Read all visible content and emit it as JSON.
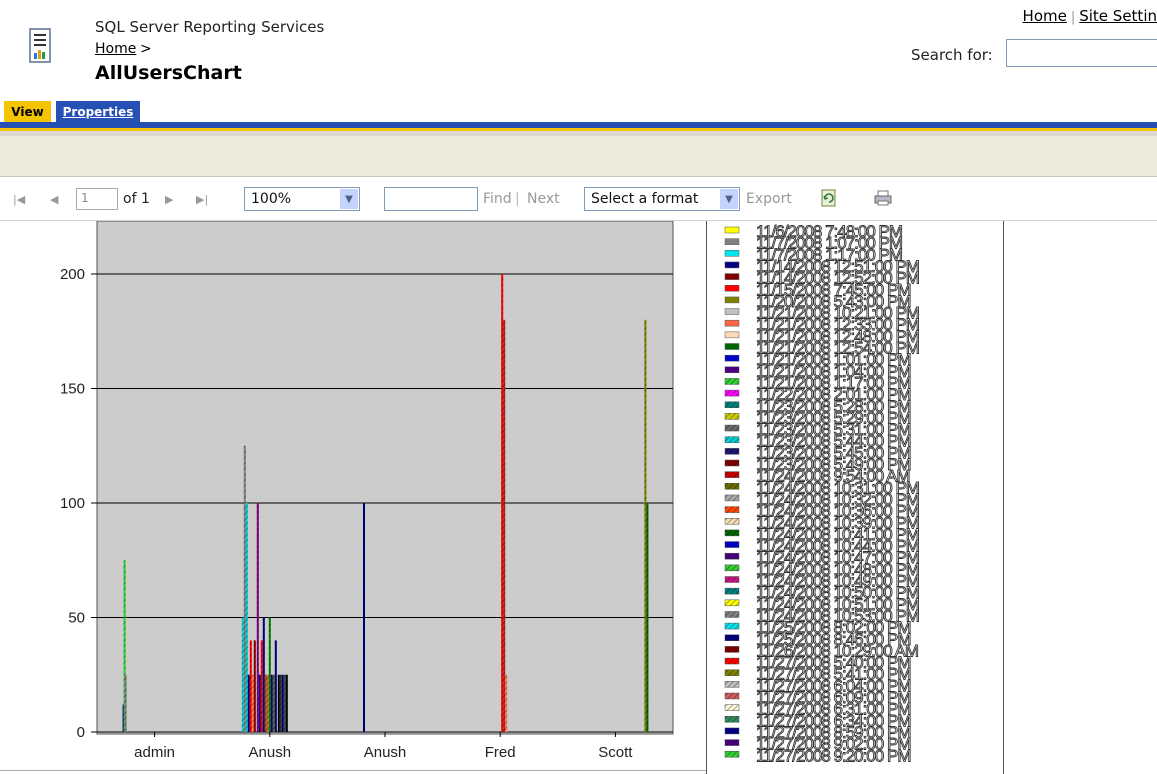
{
  "header": {
    "app_name": "SQL Server Reporting Services",
    "breadcrumb_home": "Home",
    "breadcrumb_sep": ">",
    "report_title": "AllUsersChart",
    "top_links": [
      "Home",
      "Site Settin"
    ],
    "search_label": "Search for:"
  },
  "tabs": [
    {
      "label": "View",
      "active": true
    },
    {
      "label": "Properties",
      "active": false
    }
  ],
  "toolbar": {
    "page_value": "1",
    "page_of": "of 1",
    "zoom": "100%",
    "find_label": "Find",
    "find_sep": "|",
    "next_label": "Next",
    "format_placeholder": "Select a format",
    "export_label": "Export"
  },
  "colors": {
    "tab_view": "#f4c400",
    "tab_properties": "#2650b3",
    "plot_background": "#cccccc"
  },
  "chart_data": {
    "type": "bar",
    "categories": [
      "admin",
      "Anush",
      "Anush",
      "Fred",
      "Scott"
    ],
    "y_ticks": [
      0,
      50,
      100,
      150,
      200
    ],
    "ylim": [
      0,
      220
    ],
    "grid": true,
    "legend_position": "right",
    "bars": [
      {
        "cat": 0,
        "off": -32,
        "v": 12,
        "c": "#000080"
      },
      {
        "cat": 0,
        "off": -31,
        "v": 75,
        "c": "#32cd32"
      },
      {
        "cat": 0,
        "off": -30,
        "v": 25,
        "c": "#808080"
      },
      {
        "cat": 1,
        "off": -28,
        "v": 50,
        "c": "#00ced1"
      },
      {
        "cat": 1,
        "off": -26,
        "v": 125,
        "c": "#808080"
      },
      {
        "cat": 1,
        "off": -24,
        "v": 100,
        "c": "#00ced1"
      },
      {
        "cat": 1,
        "off": -22,
        "v": 25,
        "c": "#000080"
      },
      {
        "cat": 1,
        "off": -20,
        "v": 40,
        "c": "#ff0000"
      },
      {
        "cat": 1,
        "off": -18,
        "v": 25,
        "c": "#ff7f50"
      },
      {
        "cat": 1,
        "off": -16,
        "v": 40,
        "c": "#8b0000"
      },
      {
        "cat": 1,
        "off": -13,
        "v": 100,
        "c": "#800080"
      },
      {
        "cat": 1,
        "off": -11,
        "v": 25,
        "c": "#000080"
      },
      {
        "cat": 1,
        "off": -9,
        "v": 40,
        "c": "#ff0000"
      },
      {
        "cat": 1,
        "off": -7,
        "v": 50,
        "c": "#000080"
      },
      {
        "cat": 1,
        "off": -5,
        "v": 25,
        "c": "#a0522d"
      },
      {
        "cat": 1,
        "off": -3,
        "v": 25,
        "c": "#d2691e"
      },
      {
        "cat": 1,
        "off": -1,
        "v": 50,
        "c": "#008000"
      },
      {
        "cat": 1,
        "off": 1,
        "v": 25,
        "c": "#000080"
      },
      {
        "cat": 1,
        "off": 3,
        "v": 25,
        "c": "#556b2f"
      },
      {
        "cat": 1,
        "off": 5,
        "v": 40,
        "c": "#000080"
      },
      {
        "cat": 1,
        "off": 8,
        "v": 25,
        "c": "#000000"
      },
      {
        "cat": 1,
        "off": 10,
        "v": 25,
        "c": "#333333"
      },
      {
        "cat": 1,
        "off": 12,
        "v": 25,
        "c": "#000080"
      },
      {
        "cat": 1,
        "off": 14,
        "v": 25,
        "c": "#2f4f4f"
      },
      {
        "cat": 1,
        "off": 16,
        "v": 25,
        "c": "#000000"
      },
      {
        "cat": 2,
        "off": -22,
        "v": 100,
        "c": "#000080"
      },
      {
        "cat": 3,
        "off": 1,
        "v": 200,
        "c": "#ff0000"
      },
      {
        "cat": 3,
        "off": 3,
        "v": 180,
        "c": "#b22222"
      },
      {
        "cat": 3,
        "off": 5,
        "v": 25,
        "c": "#ff7f50"
      },
      {
        "cat": 4,
        "off": 29,
        "v": 180,
        "c": "#808000"
      },
      {
        "cat": 4,
        "off": 31,
        "v": 100,
        "c": "#006400"
      }
    ],
    "legend": [
      {
        "label": "11/6/2008 7:48:00 PM",
        "color": "#ffff00"
      },
      {
        "label": "11/7/2008 1:07:00 PM",
        "color": "#808080"
      },
      {
        "label": "11/7/2008 1:17:00 PM",
        "color": "#00e5ee"
      },
      {
        "label": "11/14/2008 12:51:00 PM",
        "color": "#000080"
      },
      {
        "label": "11/14/2008 12:52:00 PM",
        "color": "#800000"
      },
      {
        "label": "11/15/2008 7:45:00 PM",
        "color": "#ff0000"
      },
      {
        "label": "11/20/2008 5:43:00 PM",
        "color": "#808000"
      },
      {
        "label": "11/21/2008 10:21:00 PM",
        "color": "#c0c0c0"
      },
      {
        "label": "11/21/2008 12:33:00 PM",
        "color": "#ff6347"
      },
      {
        "label": "11/21/2008 12:48:00 PM",
        "color": "#ffdab9"
      },
      {
        "label": "11/21/2008 12:54:00 PM",
        "color": "#006400"
      },
      {
        "label": "11/21/2008 1:01:00 PM",
        "color": "#0000cd"
      },
      {
        "label": "11/21/2008 1:04:00 PM",
        "color": "#4b0082"
      },
      {
        "label": "11/21/2008 1:17:00 PM",
        "color": "#32cd32"
      },
      {
        "label": "11/22/2008 2:01:00 PM",
        "color": "#ff00ff"
      },
      {
        "label": "11/23/2008 5:28:00 PM",
        "color": "#008080"
      },
      {
        "label": "11/23/2008 5:29:00 PM",
        "color": "#cccc00"
      },
      {
        "label": "11/23/2008 5:31:00 PM",
        "color": "#696969"
      },
      {
        "label": "11/23/2008 5:44:00 PM",
        "color": "#00ced1"
      },
      {
        "label": "11/23/2008 5:45:00 PM",
        "color": "#191970"
      },
      {
        "label": "11/23/2008 5:49:00 PM",
        "color": "#800000"
      },
      {
        "label": "11/24/2008 9:54:00 AM",
        "color": "#cc0000"
      },
      {
        "label": "11/24/2008 10:31:00 PM",
        "color": "#6b6b00"
      },
      {
        "label": "11/24/2008 10:32:00 PM",
        "color": "#a9a9a9"
      },
      {
        "label": "11/24/2008 10:36:00 PM",
        "color": "#ff4500"
      },
      {
        "label": "11/24/2008 10:39:00 PM",
        "color": "#f5deb3"
      },
      {
        "label": "11/24/2008 10:41:00 PM",
        "color": "#006400"
      },
      {
        "label": "11/24/2008 10:44:00 PM",
        "color": "#0000cd"
      },
      {
        "label": "11/24/2008 10:47:00 PM",
        "color": "#4b0082"
      },
      {
        "label": "11/24/2008 10:48:00 PM",
        "color": "#32cd32"
      },
      {
        "label": "11/24/2008 10:49:00 PM",
        "color": "#c71585"
      },
      {
        "label": "11/24/2008 10:50:00 PM",
        "color": "#008080"
      },
      {
        "label": "11/24/2008 10:51:00 PM",
        "color": "#ffff00"
      },
      {
        "label": "11/24/2008 10:53:00 PM",
        "color": "#808080"
      },
      {
        "label": "11/25/2008 8:02:00 PM",
        "color": "#00e5ee"
      },
      {
        "label": "11/25/2008 8:46:00 PM",
        "color": "#000080"
      },
      {
        "label": "11/26/2008 10:29:00 AM",
        "color": "#800000"
      },
      {
        "label": "11/27/2008 5:40:00 PM",
        "color": "#ff0000"
      },
      {
        "label": "11/27/2008 5:41:00 PM",
        "color": "#808000"
      },
      {
        "label": "11/27/2008 6:04:00 PM",
        "color": "#c0c0c0"
      },
      {
        "label": "11/27/2008 6:09:00 PM",
        "color": "#cd5c5c"
      },
      {
        "label": "11/27/2008 6:31:00 PM",
        "color": "#fff8dc"
      },
      {
        "label": "11/27/2008 6:34:00 PM",
        "color": "#2e8b57"
      },
      {
        "label": "11/27/2008 8:59:00 PM",
        "color": "#00008b"
      },
      {
        "label": "11/27/2008 9:02:00 PM",
        "color": "#4b0082"
      },
      {
        "label": "11/27/2008 9:20:00 PM",
        "color": "#32cd32"
      }
    ]
  }
}
